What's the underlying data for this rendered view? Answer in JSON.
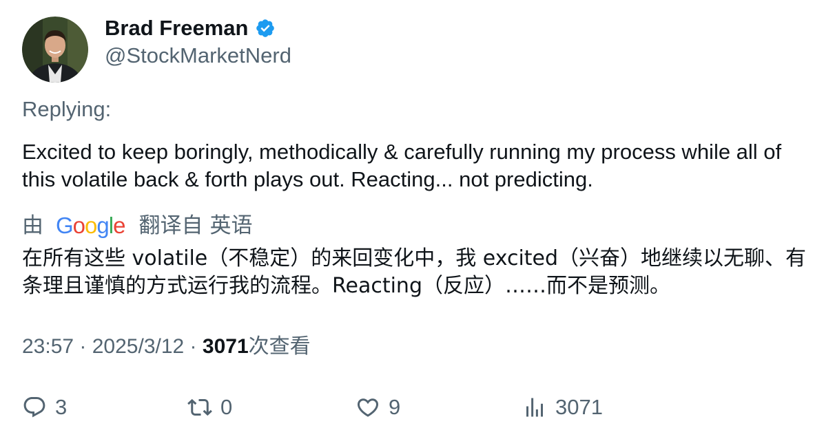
{
  "author": {
    "name": "Brad Freeman",
    "handle": "@StockMarketNerd",
    "verified": true,
    "avatar_icon": "person-avatar"
  },
  "replying_label": "Replying:",
  "tweet_text": "Excited to keep boringly, methodically & carefully running my process while all of this volatile back & forth plays out. Reacting... not predicting.",
  "translation": {
    "by_label": "由",
    "provider": "Google",
    "from_label": "翻译自",
    "language": "英语",
    "text": "在所有这些 volatile（不稳定）的来回变化中，我 excited（兴奋）地继续以无聊、有条理且谨慎的方式运行我的流程。Reacting（反应）……而不是预测。"
  },
  "meta": {
    "time": "23:57",
    "separator1": " · ",
    "date": "2025/3/12",
    "separator2": " · ",
    "views_count": "3071",
    "views_label": "次查看"
  },
  "actions": {
    "reply_count": "3",
    "retweet_count": "0",
    "like_count": "9",
    "views_count": "3071"
  },
  "colors": {
    "text_primary": "#0f1419",
    "text_secondary": "#536471",
    "verified_blue": "#1d9bf0"
  }
}
